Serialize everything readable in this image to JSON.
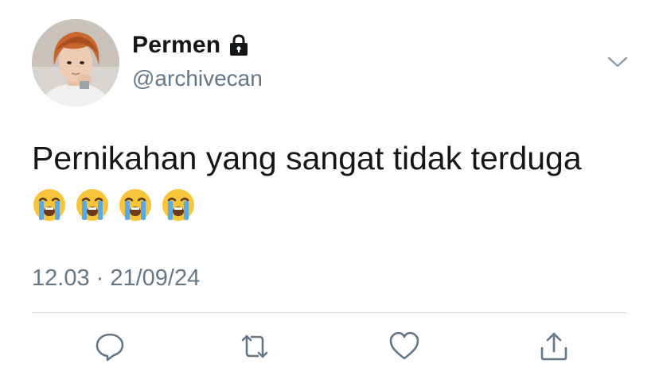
{
  "tweet": {
    "author": {
      "display_name": "Permen",
      "handle": "@archivecan",
      "protected_icon": "lock-icon",
      "avatar": "profile-photo"
    },
    "text": "Pernikahan yang sangat tidak terduga",
    "emojis": [
      "loudly-crying-face",
      "loudly-crying-face",
      "loudly-crying-face",
      "loudly-crying-face"
    ],
    "timestamp": "12.03 · 21/09/24",
    "menu_icon": "chevron-down-icon",
    "actions": [
      {
        "name": "reply",
        "icon": "comment-icon"
      },
      {
        "name": "retweet",
        "icon": "retweet-icon"
      },
      {
        "name": "like",
        "icon": "heart-icon"
      },
      {
        "name": "share",
        "icon": "share-icon"
      }
    ]
  },
  "colors": {
    "text_primary": "#14171a",
    "text_secondary": "#657786",
    "icon": "#657786",
    "divider": "#d9dde1",
    "background": "#ffffff"
  }
}
